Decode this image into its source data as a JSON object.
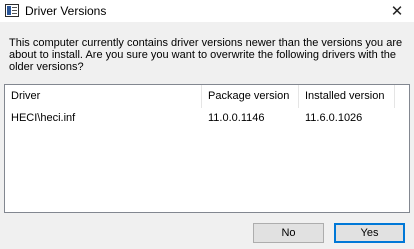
{
  "window": {
    "title": "Driver Versions",
    "icon": "app-window-icon",
    "close_glyph": "✕"
  },
  "message": "This computer currently contains driver versions newer than the versions you are about to install. Are you sure you want to overwrite the following drivers with the older versions?",
  "table": {
    "columns": [
      "Driver",
      "Package version",
      "Installed version"
    ],
    "rows": [
      [
        "HECI\\heci.inf",
        "11.0.0.1146",
        "11.6.0.1026"
      ]
    ]
  },
  "buttons": {
    "no": "No",
    "yes": "Yes"
  },
  "colors": {
    "default_button_border": "#0078d7"
  }
}
